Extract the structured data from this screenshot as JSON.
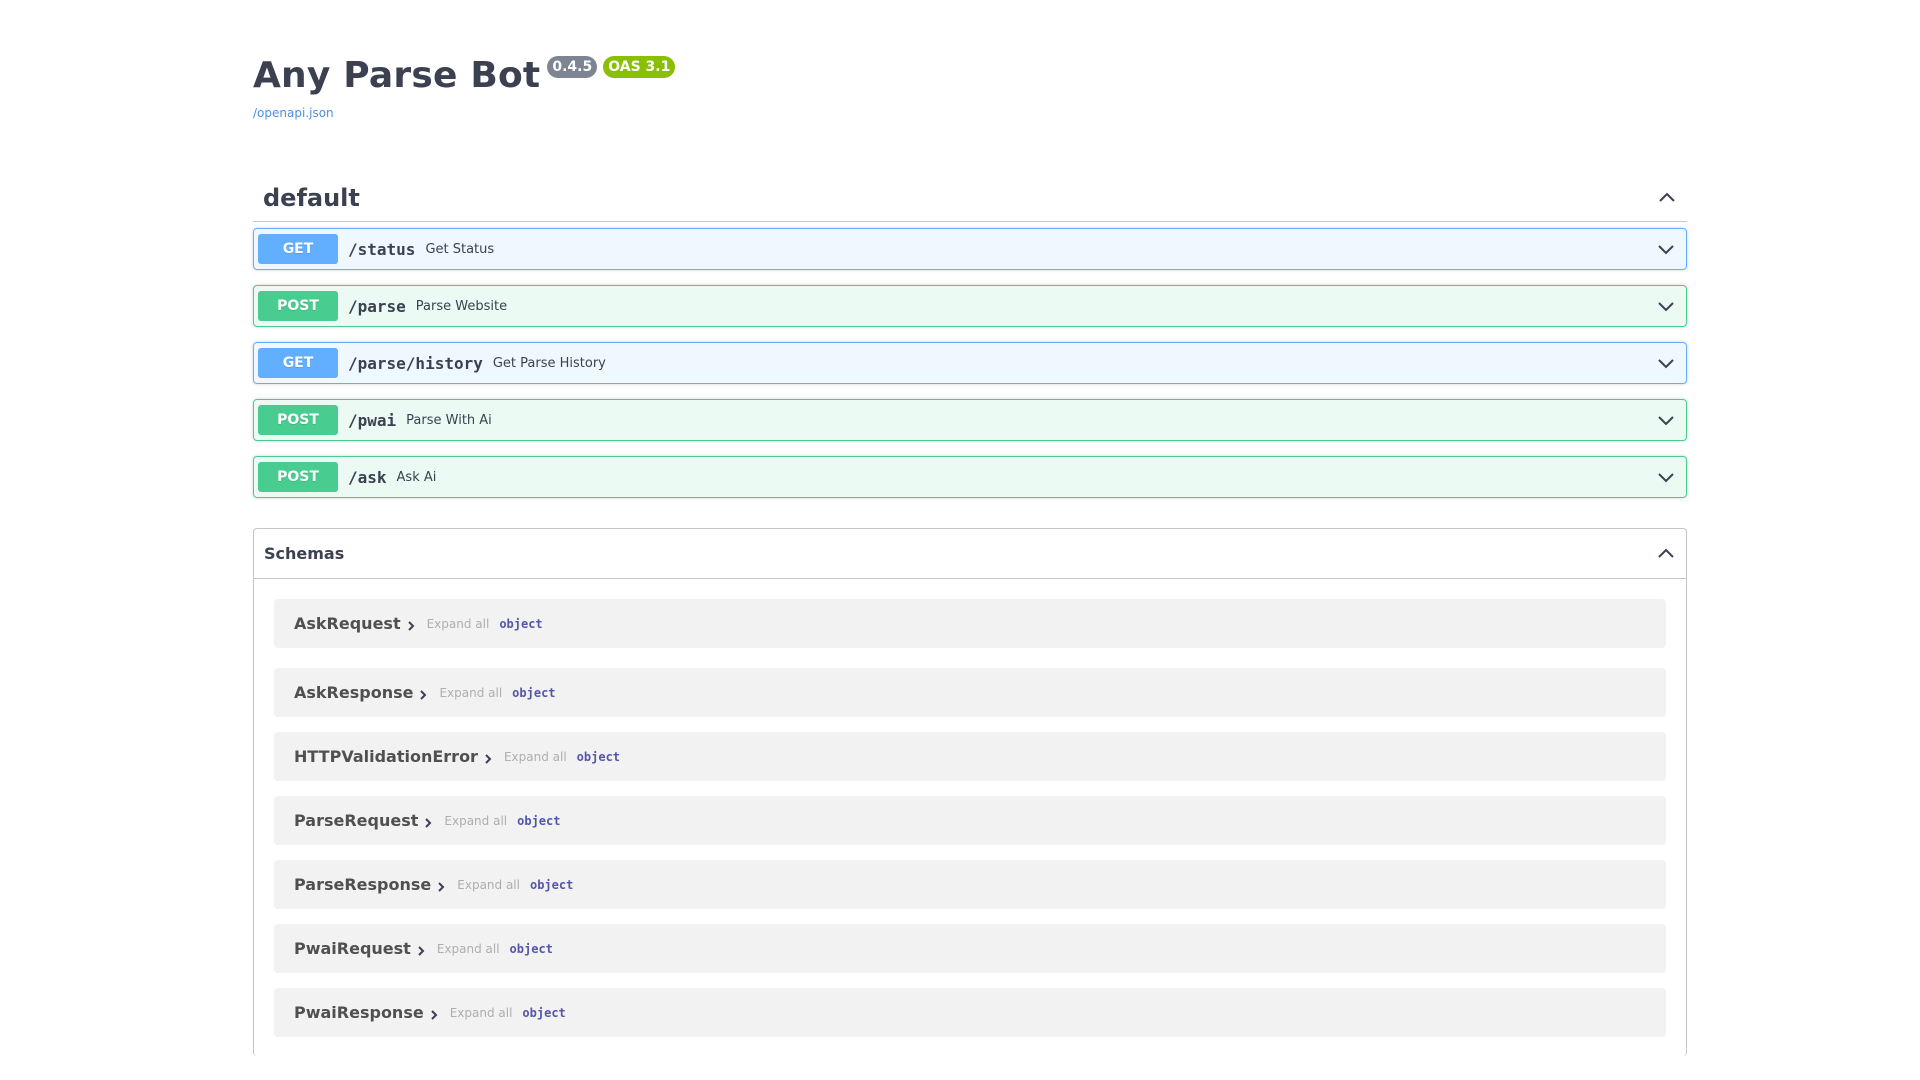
{
  "info": {
    "title": "Any Parse Bot",
    "version": "0.4.5",
    "oas": "OAS 3.1",
    "spec_link": "/openapi.json"
  },
  "tag": {
    "title": "default",
    "operations": [
      {
        "method": "GET",
        "path": "/status",
        "summary": "Get Status"
      },
      {
        "method": "POST",
        "path": "/parse",
        "summary": "Parse Website"
      },
      {
        "method": "GET",
        "path": "/parse/history",
        "summary": "Get Parse History"
      },
      {
        "method": "POST",
        "path": "/pwai",
        "summary": "Parse With Ai"
      },
      {
        "method": "POST",
        "path": "/ask",
        "summary": "Ask Ai"
      }
    ]
  },
  "schemas": {
    "title": "Schemas",
    "expand_label": "Expand all",
    "items": [
      {
        "name": "AskRequest",
        "type": "object"
      },
      {
        "name": "AskResponse",
        "type": "object"
      },
      {
        "name": "HTTPValidationError",
        "type": "object"
      },
      {
        "name": "ParseRequest",
        "type": "object"
      },
      {
        "name": "ParseResponse",
        "type": "object"
      },
      {
        "name": "PwaiRequest",
        "type": "object"
      },
      {
        "name": "PwaiResponse",
        "type": "object"
      }
    ]
  },
  "colors": {
    "get": "#61affe",
    "post": "#49cc90",
    "version_badge": "#7d8492",
    "oas_badge": "#89bf04",
    "link": "#4990e2"
  },
  "icons": {
    "tag_toggle": "chevron-up-icon",
    "operation_toggle": "chevron-down-icon",
    "schemas_toggle": "chevron-up-icon",
    "model_toggle": "chevron-right-icon"
  }
}
